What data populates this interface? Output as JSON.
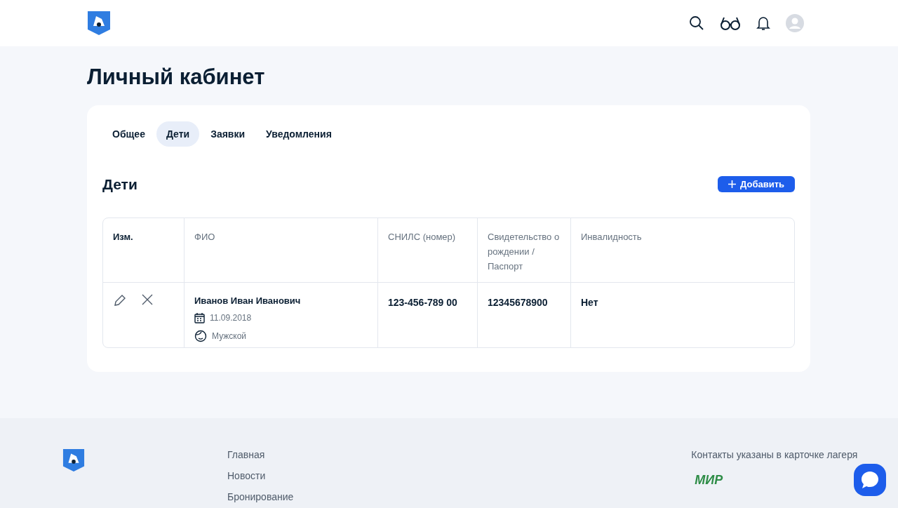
{
  "page_title": "Личный кабинет",
  "tabs": [
    {
      "label": "Общее",
      "selected": false
    },
    {
      "label": "Дети",
      "selected": true
    },
    {
      "label": "Заявки",
      "selected": false
    },
    {
      "label": "Уведомления",
      "selected": false
    }
  ],
  "section": {
    "title": "Дети",
    "add_button": "Добавить"
  },
  "table": {
    "columns": [
      "Изм.",
      "ФИО",
      "СНИЛС (номер)",
      "Свидетельство о рождении / Паспорт",
      "Инвалидность"
    ],
    "rows": [
      {
        "name": "Иванов Иван Иванович",
        "birth_date": "11.09.2018",
        "gender": "Мужской",
        "snils": "123-456-789 00",
        "certificate": "12345678900",
        "disability": "Нет"
      }
    ]
  },
  "footer": {
    "links": [
      "Главная",
      "Новости",
      "Бронирование"
    ],
    "contacts": "Контакты указаны в карточке лагеря",
    "payment_logo": "МИР"
  }
}
